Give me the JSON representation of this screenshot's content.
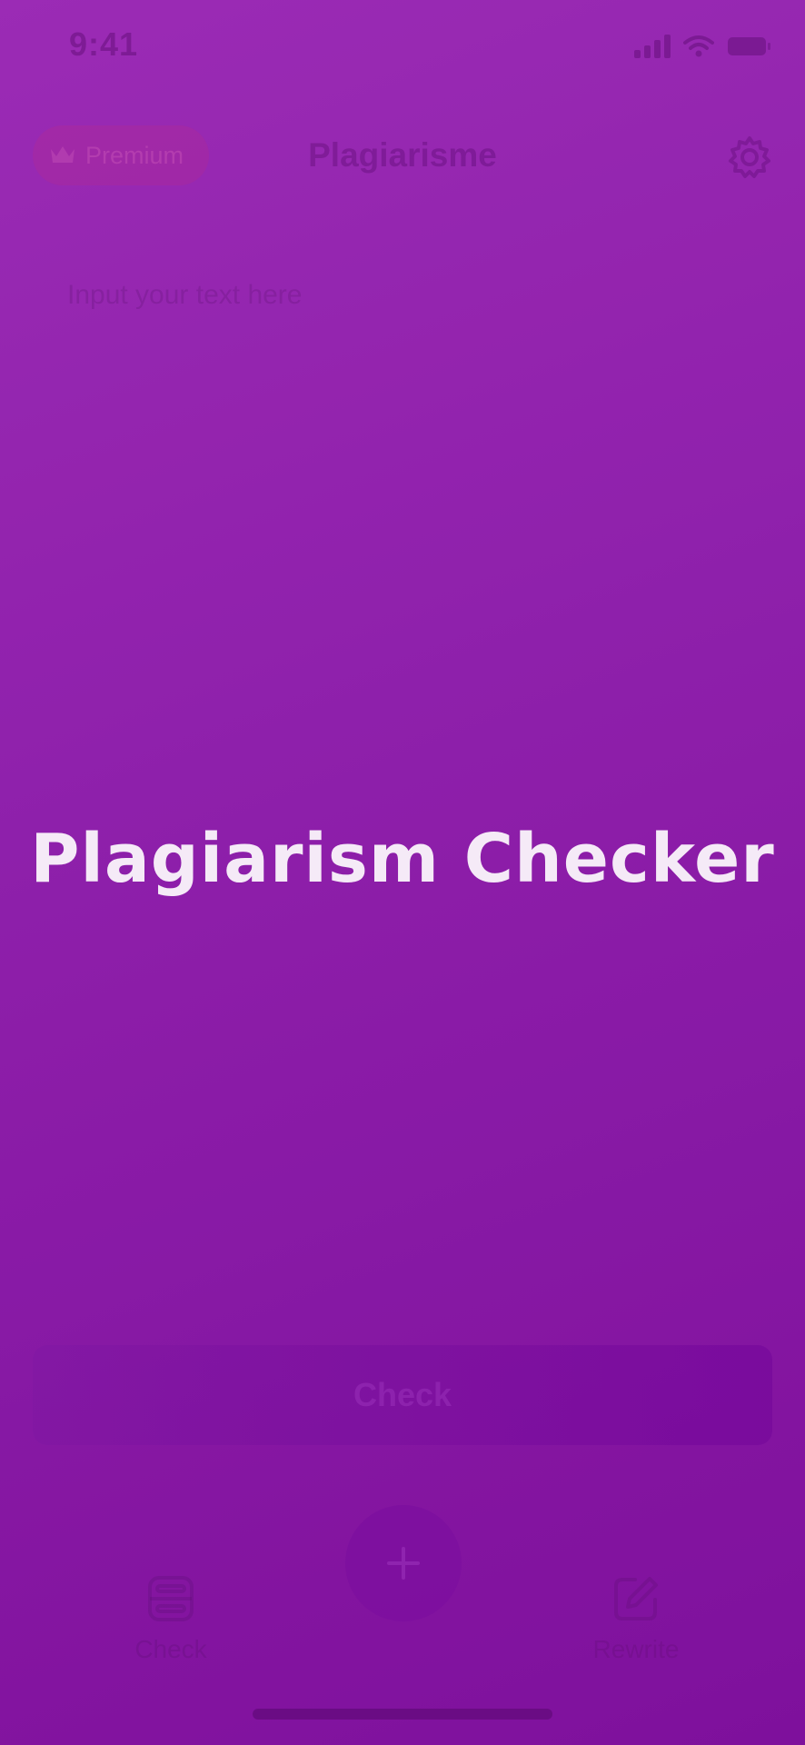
{
  "status_bar": {
    "time": "9:41",
    "icons": [
      "signal-icon",
      "wifi-icon",
      "battery-icon"
    ]
  },
  "header": {
    "premium_label": "Premium",
    "premium_icon": "crown-icon",
    "title": "Plagiarisme",
    "settings_icon": "gear-icon"
  },
  "editor": {
    "placeholder": "Input your text here",
    "value": ""
  },
  "actions": {
    "check_label": "Check"
  },
  "tab_bar": {
    "center_icon": "plus-icon",
    "items": [
      {
        "label": "Check",
        "icon": "check-tab-icon"
      },
      {
        "label": "Rewrite",
        "icon": "edit-icon"
      }
    ]
  },
  "overlay": {
    "title": "Plagiarism Checker"
  },
  "colors": {
    "background_top": "#9c2cb5",
    "background_bottom": "#7c0d99",
    "overlay_text": "#f5eaf7"
  }
}
